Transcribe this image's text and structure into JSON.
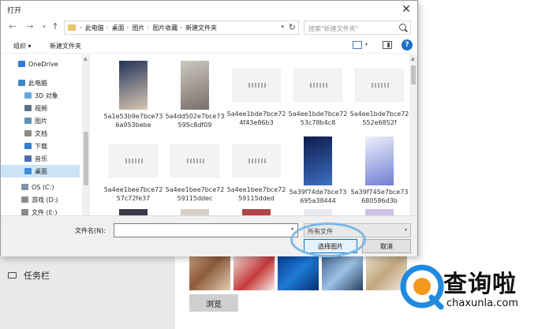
{
  "background": {
    "taskbar_label": "任务栏",
    "browse_label": "浏览"
  },
  "watermark": {
    "name": "查询啦",
    "url": "chaxunla.com"
  },
  "dialog": {
    "title": "打开",
    "breadcrumbs": [
      "此电脑",
      "桌面",
      "图片",
      "图片收藏",
      "新建文件夹"
    ],
    "search_placeholder": "搜索\"新建文件夹\"",
    "toolbar": {
      "organize": "组织 ▾",
      "new_folder": "新建文件夹"
    },
    "nav_items": [
      {
        "label": "OneDrive",
        "icon": "cloud-icon",
        "color": "#2e7bd6"
      },
      {
        "label": "此电脑",
        "icon": "computer-icon",
        "color": "#3b88c4"
      },
      {
        "label": "3D 对象",
        "icon": "cube-icon",
        "color": "#6aa7d8"
      },
      {
        "label": "视频",
        "icon": "video-icon",
        "color": "#5f6f86"
      },
      {
        "label": "图片",
        "icon": "picture-icon",
        "color": "#5f8fb8"
      },
      {
        "label": "文档",
        "icon": "document-icon",
        "color": "#8a8a8a"
      },
      {
        "label": "下载",
        "icon": "download-icon",
        "color": "#2d7fd4"
      },
      {
        "label": "音乐",
        "icon": "music-icon",
        "color": "#4f6fa8"
      },
      {
        "label": "桌面",
        "icon": "desktop-icon",
        "color": "#3d8fd6",
        "selected": true
      },
      {
        "label": "OS (C:)",
        "icon": "drive-icon",
        "color": "#7e94a8"
      },
      {
        "label": "游戏 (D:)",
        "icon": "drive-icon",
        "color": "#8b8b8b"
      },
      {
        "label": "文件 (E:)",
        "icon": "drive-icon",
        "color": "#8b8b8b"
      }
    ],
    "files": [
      {
        "name": "5a1e53b9e7bce736a953bebe",
        "kind": "tall",
        "colors": [
          "#24345a",
          "#d7c7b2"
        ]
      },
      {
        "name": "5a4dd502e7bce73595c8df09",
        "kind": "tall",
        "colors": [
          "#ccc7c2",
          "#7a6f6a"
        ]
      },
      {
        "name": "5a4ee1bde7bce724f43e86b3",
        "kind": "wide"
      },
      {
        "name": "5a4ee1bde7bce7253c78b4c8",
        "kind": "wide"
      },
      {
        "name": "5a4ee1bde7bce72552e6852f",
        "kind": "wide"
      },
      {
        "name": "5a4ee1bee7bce7257c72fe37",
        "kind": "wide"
      },
      {
        "name": "5a4ee1bee7bce7259115ddec",
        "kind": "wide"
      },
      {
        "name": "5a4ee1bee7bce7259115dded",
        "kind": "wide"
      },
      {
        "name": "5a39f74de7bce73695a38444",
        "kind": "tall",
        "colors": [
          "#0d1b4a",
          "#3f6fc4"
        ]
      },
      {
        "name": "5a39f745e7bce73680586d3b",
        "kind": "tall",
        "colors": [
          "#eef0fb",
          "#6f7ed4"
        ]
      }
    ],
    "filename_label": "文件名(N):",
    "filename_value": "",
    "file_type": "所有文件",
    "open_label": "选择图片",
    "cancel_label": "取消"
  }
}
